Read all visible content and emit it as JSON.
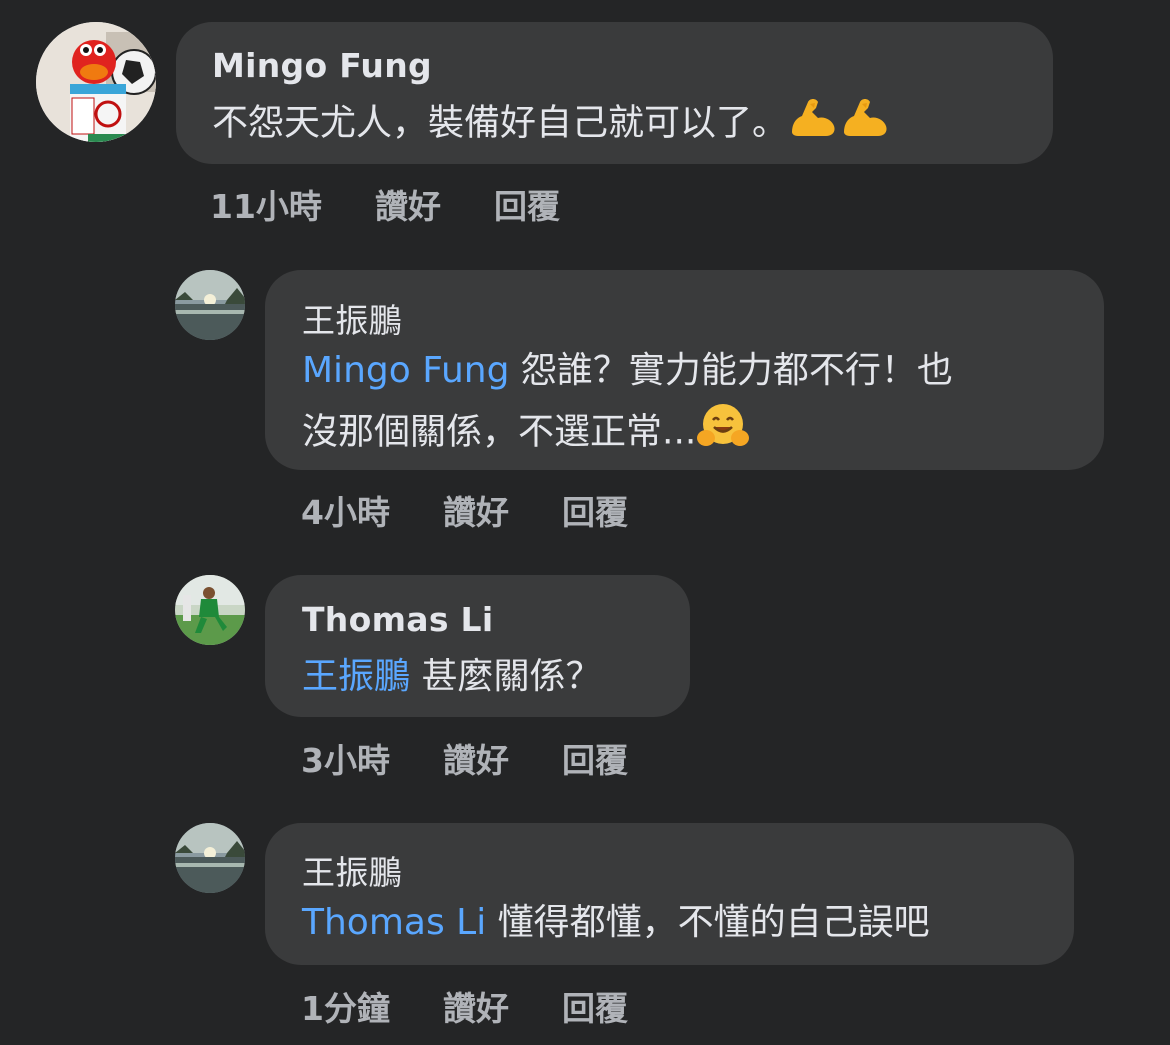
{
  "comments": [
    {
      "author": "Mingo Fung",
      "text": "不怨天尤人，裝備好自己就可以了。",
      "emojis": [
        "flexed-biceps",
        "flexed-biceps"
      ],
      "time": "11小時",
      "like": "讚好",
      "reply": "回覆"
    },
    {
      "author": "王振鵬",
      "mention": "Mingo Fung",
      "text_line1": " 怨誰？實力能力都不行！也",
      "text_line2": "沒那個關係，不選正常...",
      "emojis": [
        "hugging-face"
      ],
      "time": "4小時",
      "like": "讚好",
      "reply": "回覆"
    },
    {
      "author": "Thomas Li",
      "mention": "王振鵬",
      "text": " 甚麼關係？",
      "time": "3小時",
      "like": "讚好",
      "reply": "回覆"
    },
    {
      "author": "王振鵬",
      "mention": "Thomas Li",
      "text": " 懂得都懂，不懂的自己誤吧",
      "time": "1分鐘",
      "like": "讚好",
      "reply": "回覆"
    }
  ],
  "colors": {
    "background": "#242526",
    "bubble": "#3a3b3c",
    "text": "#e4e6eb",
    "mention": "#5aa7ff",
    "meta": "#b0b3b8"
  }
}
